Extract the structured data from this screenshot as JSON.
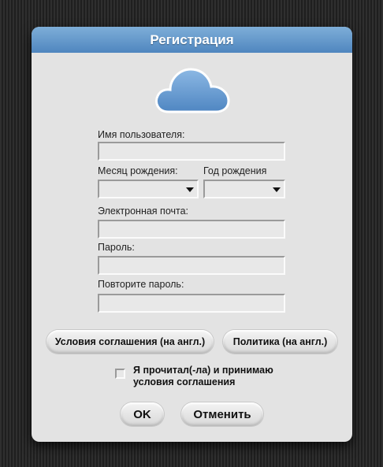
{
  "dialog": {
    "title": "Регистрация",
    "icon": "cloud-icon",
    "accent_color": "#5b90c8"
  },
  "form": {
    "username_label": "Имя пользователя:",
    "username_value": "",
    "birth_month_label": "Месяц рождения:",
    "birth_month_value": "",
    "birth_year_label": "Год рождения",
    "birth_year_value": "",
    "email_label": "Электронная почта:",
    "email_value": "",
    "password_label": "Пароль:",
    "password_value": "",
    "repeat_password_label": "Повторите пароль:",
    "repeat_password_value": ""
  },
  "links": {
    "terms_label": "Условия соглашения (на англ.)",
    "policy_label": "Политика (на англ.)"
  },
  "agreement": {
    "line1": "Я прочитал(-ла) и принимаю",
    "line2": "условия соглашения",
    "checked": false
  },
  "actions": {
    "ok_label": "OK",
    "cancel_label": "Отменить"
  }
}
